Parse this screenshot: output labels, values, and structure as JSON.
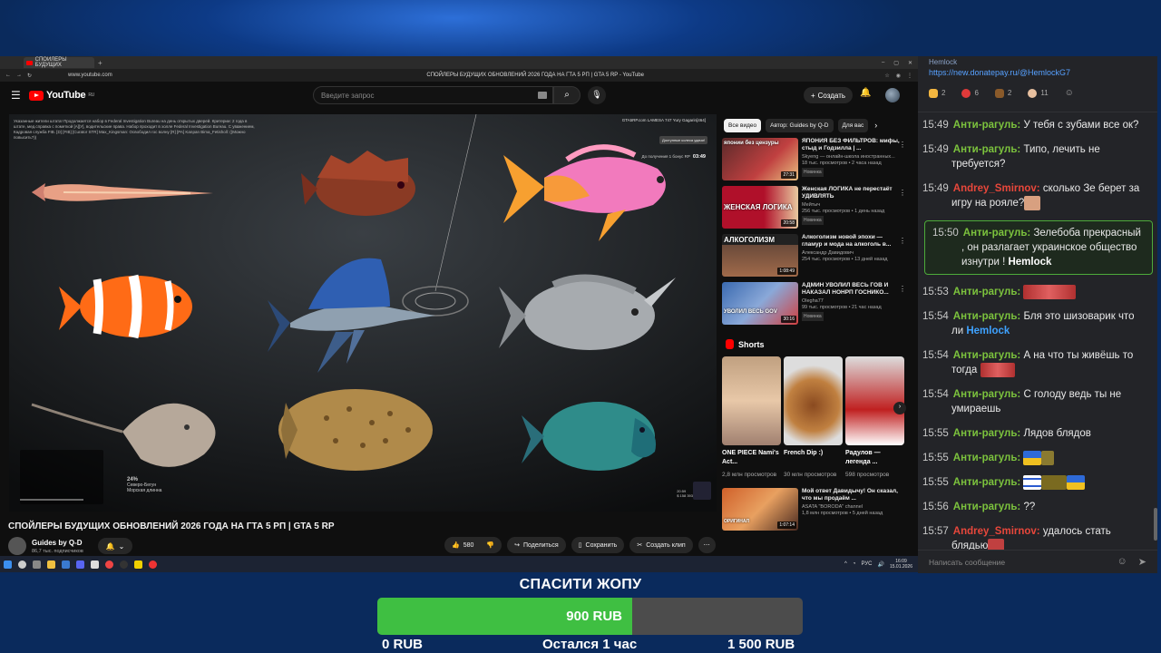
{
  "browser": {
    "tab_title": "СПОЙЛЕРЫ БУДУЩИХ",
    "url": "www.youtube.com",
    "page_title": "СПОЙЛЕРЫ БУДУЩИХ ОБНОВЛЕНИЙ 2026 ГОДА НА ГТА 5 РП | GTA 5 RP - YouTube"
  },
  "youtube": {
    "logo_text": "YouTube",
    "region": "RU",
    "search_placeholder": "Введите запрос",
    "create_label": "Создать",
    "video_title": "СПОЙЛЕРЫ БУДУЩИХ ОБНОВЛЕНИЙ 2026 ГОДА НА ГТА 5 РП | GTA 5 RP",
    "channel_name": "Guides by Q-D",
    "channel_subs": "86,7 тыс. подписчиков",
    "likes": "580",
    "share_label": "Поделиться",
    "save_label": "Сохранить",
    "clip_label": "Создать клип",
    "chips": [
      "Все видео",
      "Автор: Guides by Q-D",
      "Для вас"
    ],
    "overlay_text": "Указанные жители штата! Продолжается набор в Federal Investigation Bureau на день открытых дверей. Критерии: 2 года в штате, мед.справка с пометкой [А][У], водительские права. Набор проходит в холле Federal Investigation Bureau. С уважением, Кадровая служба FIB. [D] [FIB] [Curator STR] Max_Kingsman: Освободил гос волну [R] [PA] Kanpan Bima_Fetisholl: ((Можно повысить?))",
    "game_logo": "GTA5RP.com LAMESA 747 Yury Gagarin[464]",
    "game_button": "Доступные колеса удачи!",
    "game_timer_label": "До получения 1 бонус RP",
    "game_timer": "03:49",
    "hud_percent": "24%",
    "hud_label": "Северо-Бегун Морская длинна",
    "hud_time": "20:59",
    "hud_money": "$ 158 393",
    "recs": [
      {
        "thumb_text": "японии без цензуры",
        "duration": "27:31",
        "title": "ЯПОНИЯ БЕЗ ФИЛЬТРОВ: мифы, стыд и Годзилла | ...",
        "channel": "Skyeng — онлайн-школа иностранных...",
        "meta": "18 тыс. просмотров • 2 часа назад",
        "badge": "Новинка"
      },
      {
        "thumb_text": "ЖЕНСКАЯ ЛОГИКА",
        "duration": "20:58",
        "title": "Женская ЛОГИКА не перестаёт УДИВЛЯТЬ",
        "channel": "Мейтыч",
        "meta": "256 тыс. просмотров • 1 день назад",
        "badge": "Новинка"
      },
      {
        "thumb_text": "АЛКОГОЛИЗМ",
        "duration": "1:08:49",
        "title": "Алкоголизм новой эпохи — гламур и мода на алкоголь в...",
        "channel": "Александр Давидович",
        "meta": "254 тыс. просмотров • 13 дней назад",
        "badge": ""
      },
      {
        "thumb_text": "УВОЛИЛ ВЕСЬ GOV",
        "duration": "30:16",
        "title": "АДМИН УВОЛИЛ ВЕСЬ ГОВ И НАКАЗАЛ НОНРП ГОСНИКО...",
        "channel": "Olegha77",
        "meta": "99 тыс. просмотров • 21 час назад",
        "badge": "Новинка"
      }
    ],
    "shorts_label": "Shorts",
    "shorts": [
      {
        "title": "ONE PIECE Nami's Act...",
        "views": "2,8 млн просмотров"
      },
      {
        "title": "French Dip :)",
        "views": "30 млн просмотров"
      },
      {
        "title": "Радулов — легенда ...",
        "views": "598 просмотров"
      }
    ],
    "rec_bottom": {
      "duration": "1:07:14",
      "thumb_text": "ОРИГИНАЛ",
      "title": "Мой ответ Давидычу! Он сказал, что мы продаём ...",
      "channel": "ASATA \"BORODA\" channel",
      "meta": "1,8 млн просмотров • 5 дней назад"
    }
  },
  "taskbar": {
    "lang": "РУС",
    "time": "16:09",
    "date": "15.01.2026"
  },
  "chat": {
    "header": "Hemlock",
    "pinned_link": "https://new.donatepay.ru/@HemlockG7",
    "reactions": [
      "2",
      "6",
      "2",
      "11"
    ],
    "messages": [
      {
        "time": "15:49",
        "nick": "Анти-рагуль:",
        "nick_color": "green",
        "text": "У тебя с зубами все ок?"
      },
      {
        "time": "15:49",
        "nick": "Анти-рагуль:",
        "nick_color": "green",
        "text": "Типо, лечить не требуется?"
      },
      {
        "time": "15:49",
        "nick": "Andrey_Smirnov:",
        "nick_color": "red",
        "text": "сколько Зе берет за игру на рояле?"
      },
      {
        "time": "15:50",
        "nick": "Анти-рагуль:",
        "nick_color": "green",
        "text": "Зелебоба прекрасный , он разлагает украинское общество изнутри !",
        "mention": "Hemlock"
      },
      {
        "time": "15:53",
        "nick": "Анти-рагуль:",
        "nick_color": "green",
        "text": ""
      },
      {
        "time": "15:54",
        "nick": "Анти-рагуль:",
        "nick_color": "green",
        "text": "Бля это шизоварик что ли",
        "mention": "Hemlock"
      },
      {
        "time": "15:54",
        "nick": "Анти-рагуль:",
        "nick_color": "green",
        "text": "А на что ты живёшь то тогда"
      },
      {
        "time": "15:54",
        "nick": "Анти-рагуль:",
        "nick_color": "green",
        "text": "С голоду ведь ты не умираешь"
      },
      {
        "time": "15:55",
        "nick": "Анти-рагуль:",
        "nick_color": "green",
        "text": "Лядов блядов"
      },
      {
        "time": "15:55",
        "nick": "Анти-рагуль:",
        "nick_color": "green",
        "text": ""
      },
      {
        "time": "15:55",
        "nick": "Анти-рагуль:",
        "nick_color": "green",
        "text": ""
      },
      {
        "time": "15:56",
        "nick": "Анти-рагуль:",
        "nick_color": "green",
        "text": "??"
      },
      {
        "time": "15:57",
        "nick": "Andrey_Smirnov:",
        "nick_color": "red",
        "text": "удалось стать блядью"
      }
    ],
    "input_placeholder": "Написать сообщение"
  },
  "goal": {
    "title": "СПАСИТИ ЖОПУ",
    "current": "900 RUB",
    "min": "0 RUB",
    "max": "1 500 RUB",
    "remaining": "Остался 1 час",
    "progress_fraction": 0.6,
    "fill_color": "#3fbf42",
    "track_color": "#4c4c4c"
  }
}
